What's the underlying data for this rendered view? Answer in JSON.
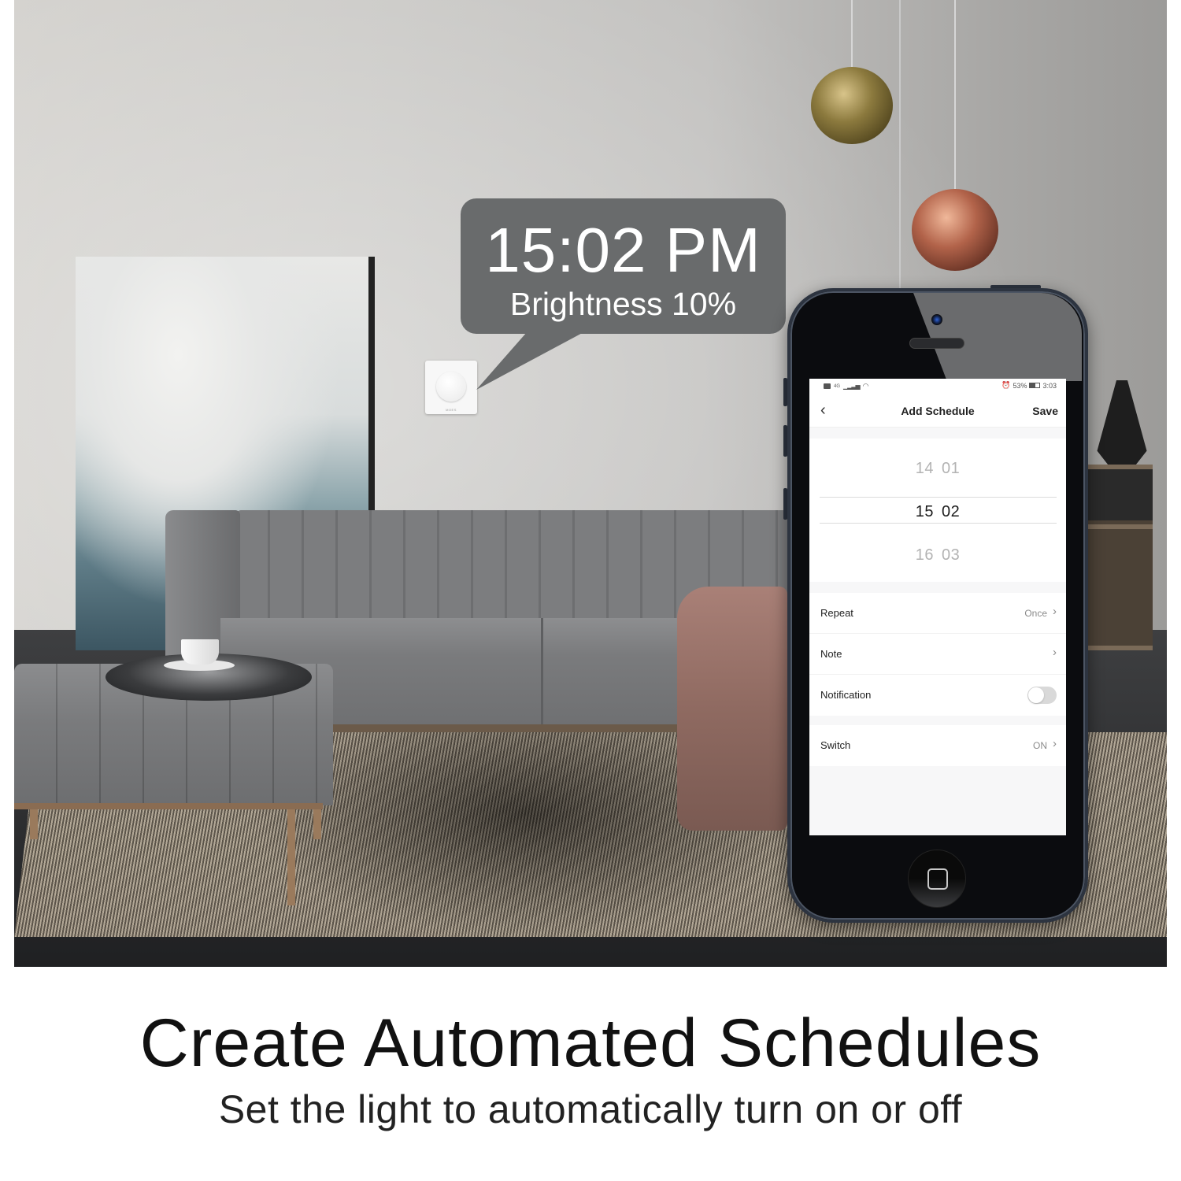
{
  "bubble": {
    "time": "15:02 PM",
    "brightness_label": "Brightness 10%",
    "brightness_percent": 10
  },
  "dimmer": {
    "brand": "MOES"
  },
  "phone": {
    "status_bar": {
      "left_icons": [
        "hd-icon",
        "4g-signal-icon",
        "wifi-icon"
      ],
      "network": "4G",
      "alarm_icon": "alarm-icon",
      "battery_percent_label": "53%",
      "battery_percent": 53,
      "time": "3:03"
    },
    "nav": {
      "back_icon": "‹",
      "title": "Add Schedule",
      "save_label": "Save"
    },
    "time_picker": {
      "rows": [
        {
          "hour": "14",
          "minute": "01",
          "selected": false
        },
        {
          "hour": "15",
          "minute": "02",
          "selected": true
        },
        {
          "hour": "16",
          "minute": "03",
          "selected": false
        }
      ]
    },
    "settings": {
      "repeat": {
        "label": "Repeat",
        "value": "Once"
      },
      "note": {
        "label": "Note",
        "value": ""
      },
      "notification": {
        "label": "Notification",
        "enabled": false
      },
      "switch": {
        "label": "Switch",
        "value": "ON"
      }
    },
    "chevron": "›"
  },
  "caption": {
    "title": "Create Automated Schedules",
    "subtitle": "Set the light to automatically turn on or off"
  },
  "colors": {
    "bubble_bg": "#696b6c",
    "phone_body": "#0b0c0f",
    "screen_bg": "#f7f7f8",
    "toggle_off": "#d9d9d9",
    "caption_text": "#111111"
  }
}
